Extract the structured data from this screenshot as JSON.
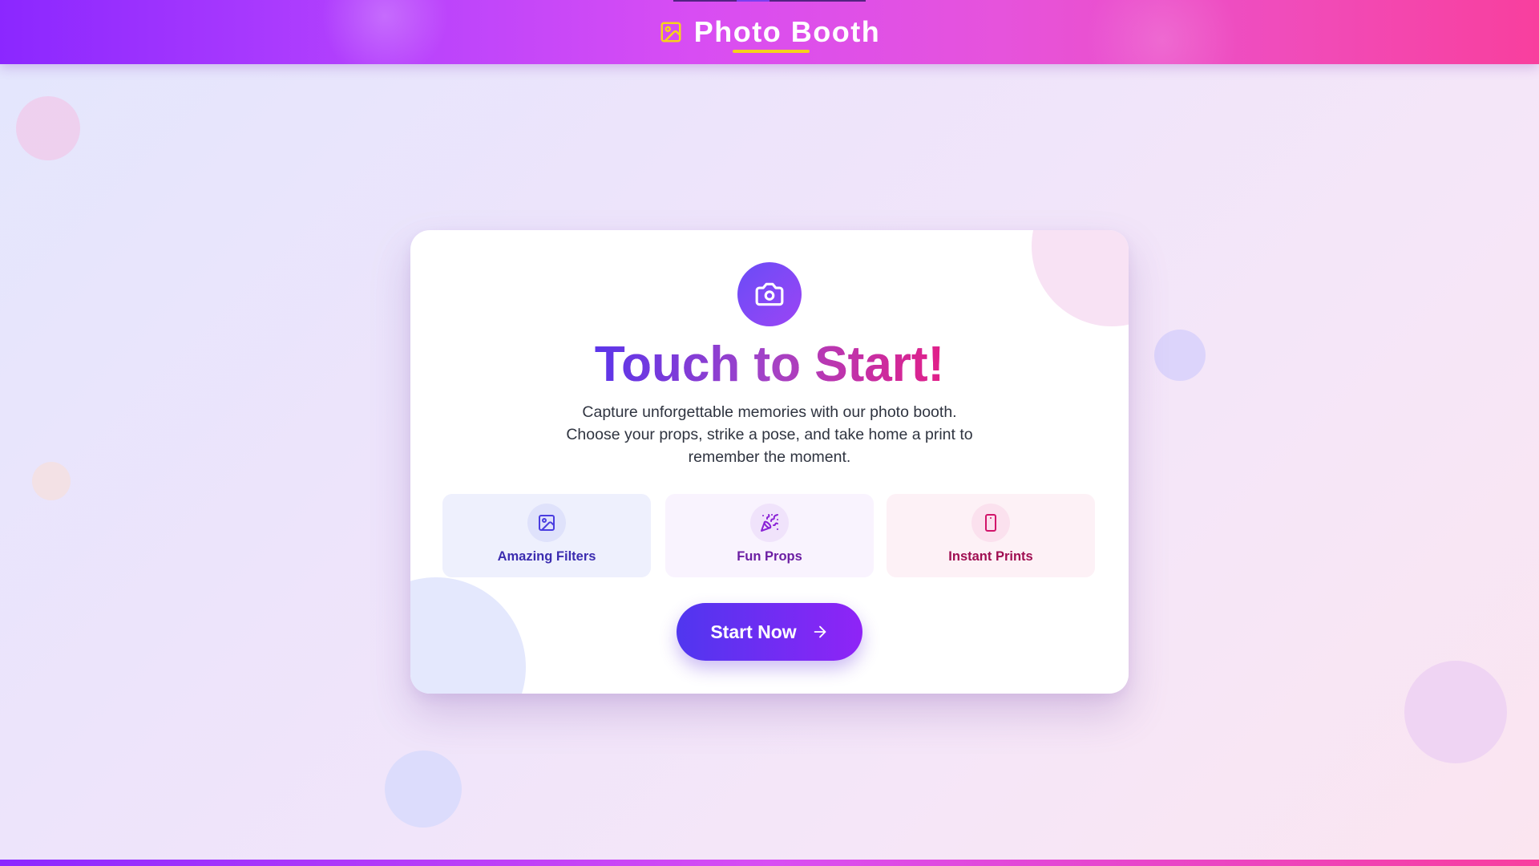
{
  "header": {
    "title": "Photo Booth",
    "icon": "image-icon"
  },
  "card": {
    "badge_icon": "camera-icon",
    "title": "Touch to Start!",
    "description": "Capture unforgettable memories with our photo booth. Choose your props, strike a pose, and take home a print to remember the moment.",
    "features": [
      {
        "label": "Amazing Filters",
        "icon": "image-icon"
      },
      {
        "label": "Fun Props",
        "icon": "party-popper-icon"
      },
      {
        "label": "Instant Prints",
        "icon": "smartphone-icon"
      }
    ],
    "start_button": {
      "label": "Start Now",
      "icon": "arrow-right-icon"
    }
  },
  "colors": {
    "header_gradient_start": "#8b27ff",
    "header_gradient_end": "#f83f9e",
    "accent_yellow": "#f6d21a",
    "button_gradient_start": "#5036ef",
    "button_gradient_end": "#8f24f6",
    "title_gradient_start": "#5b35ea",
    "title_gradient_end": "#e21f88"
  }
}
